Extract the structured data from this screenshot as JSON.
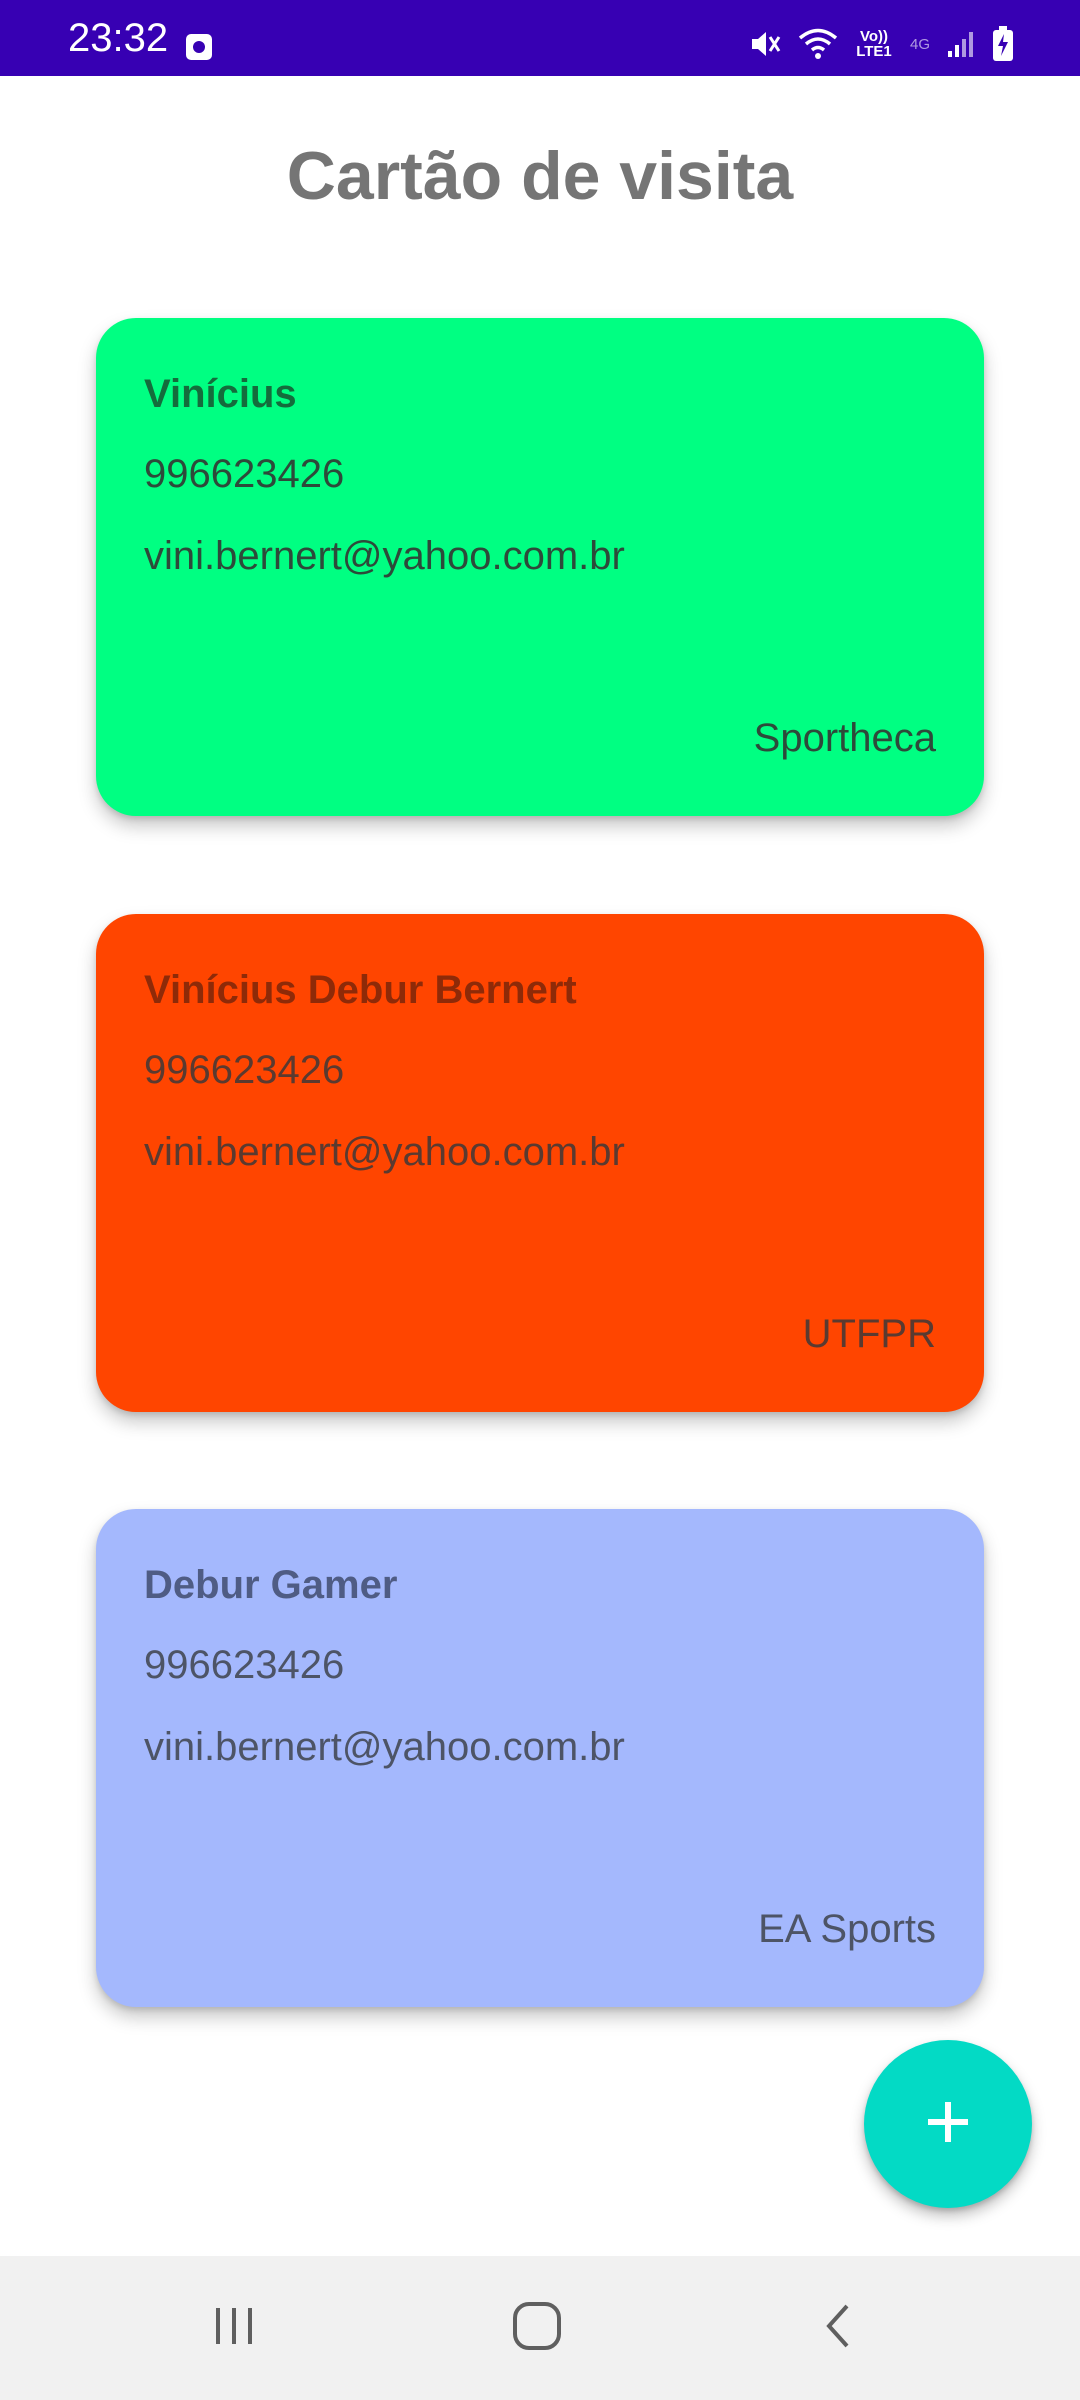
{
  "status_bar": {
    "time": "23:32",
    "network_label": "Vo)) LTE1",
    "network_type": "4G",
    "icons": [
      "notification-icon",
      "mute-icon",
      "wifi-icon",
      "lte-icon",
      "signal-icon",
      "battery-charging-icon"
    ]
  },
  "page": {
    "title": "Cartão de visita"
  },
  "cards": [
    {
      "name": "Vinícius",
      "phone": "996623426",
      "email": "vini.bernert@yahoo.com.br",
      "company": "Sportheca",
      "background": "#00ff82",
      "name_color": "#146c3c",
      "text_color": "#2d4a3a"
    },
    {
      "name": "Vinícius Debur Bernert",
      "phone": "996623426",
      "email": "vini.bernert@yahoo.com.br",
      "company": "UTFPR",
      "background": "#ff4500",
      "name_color": "#8e2a08",
      "text_color": "#5a3a30"
    },
    {
      "name": "Debur Gamer",
      "phone": "996623426",
      "email": "vini.bernert@yahoo.com.br",
      "company": "EA Sports",
      "background": "#a4b8fd",
      "name_color": "#4f5c84",
      "text_color": "#4d5466"
    }
  ],
  "fab": {
    "icon": "plus-icon",
    "color": "#03dac5"
  },
  "navigation": {
    "buttons": [
      "recent-apps-icon",
      "home-icon",
      "back-icon"
    ]
  }
}
